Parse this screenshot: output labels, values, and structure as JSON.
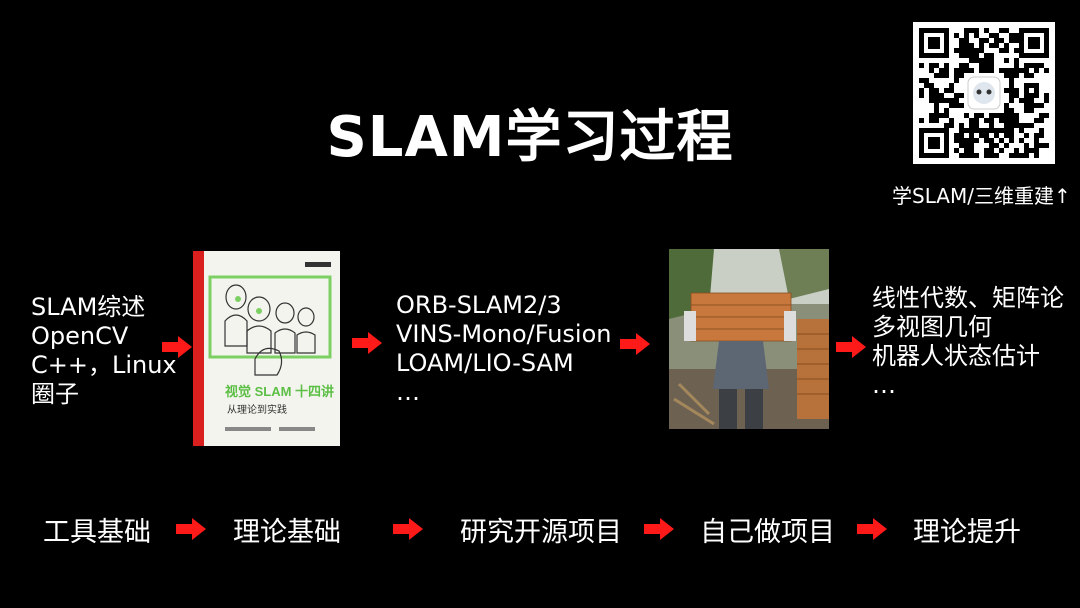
{
  "title": "SLAM学习过程",
  "qr_caption": "学SLAM/三维重建↑",
  "columns": {
    "basics": [
      "SLAM综述",
      "OpenCV",
      "C++，Linux",
      "圈子"
    ],
    "open_source": [
      "ORB-SLAM2/3",
      "VINS-Mono/Fusion",
      "LOAM/LIO-SAM",
      "…"
    ],
    "theory": [
      "线性代数、矩阵论",
      "多视图几何",
      "机器人状态估计",
      "…"
    ]
  },
  "book": {
    "title_text": "视觉 SLAM 十四讲",
    "subtitle_text": "从理论到实践"
  },
  "steps": [
    "工具基础",
    "理论基础",
    "研究开源项目",
    "自己做项目",
    "理论提升"
  ],
  "colors": {
    "arrow": "#ff1a1a",
    "background": "#000000",
    "text": "#ffffff"
  },
  "icons": [
    "qr-code-icon",
    "arrow-right-icon"
  ]
}
